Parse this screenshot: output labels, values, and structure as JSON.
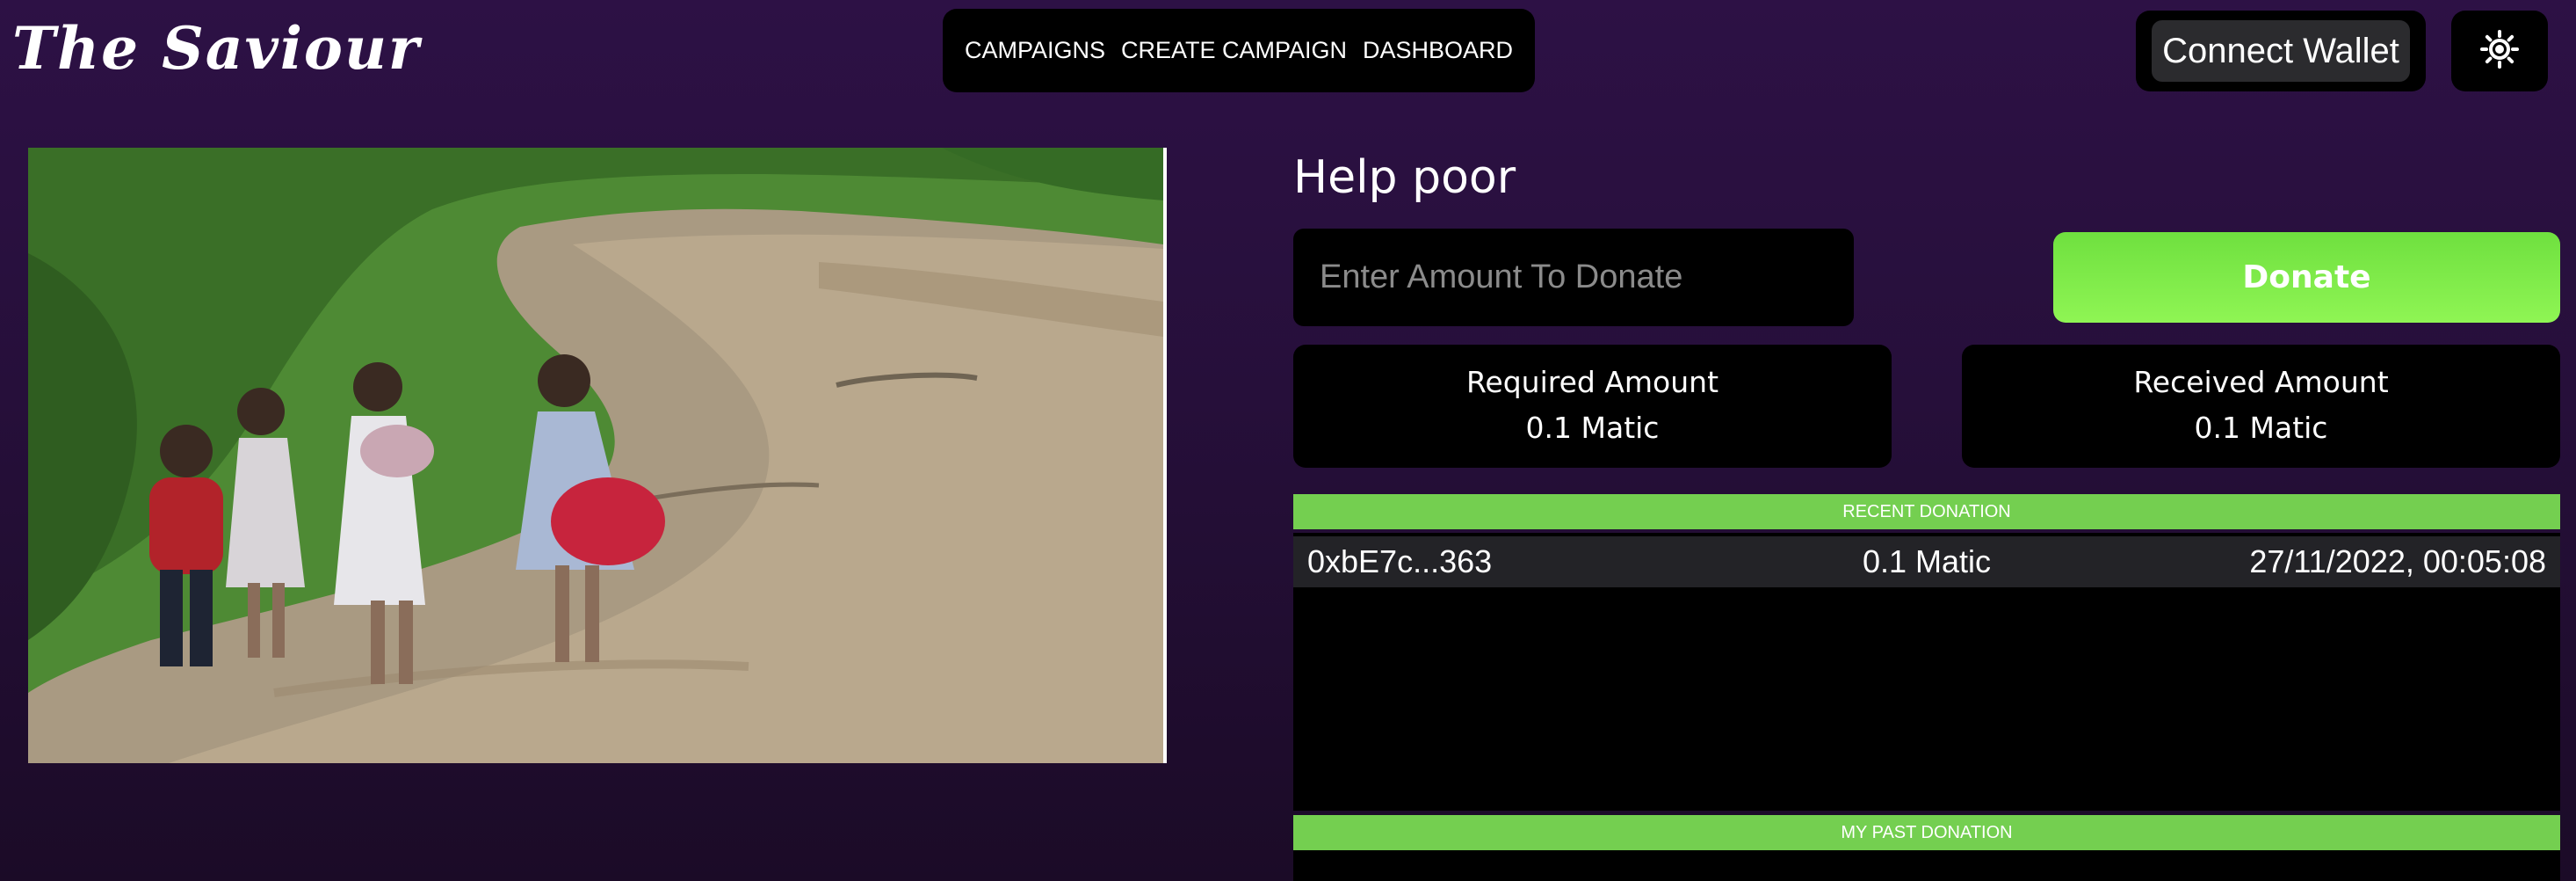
{
  "header": {
    "logo_text": "The Saviour",
    "nav": [
      {
        "label": "CAMPAIGNS"
      },
      {
        "label": "CREATE CAMPAIGN"
      },
      {
        "label": "DASHBOARD"
      }
    ],
    "connect_wallet_label": "Connect Wallet",
    "theme_toggle_icon": "sun-icon"
  },
  "campaign": {
    "image_subject": "campaign-photo",
    "title": "Help poor",
    "donate_input_placeholder": "Enter Amount To Donate",
    "donate_label": "Donate",
    "required": {
      "label": "Required Amount",
      "value": "0.1 Matic"
    },
    "received": {
      "label": "Received Amount",
      "value": "0.1 Matic"
    }
  },
  "recent_donations": {
    "header": "RECENT DONATION",
    "rows": [
      {
        "address": "0xbE7c...363",
        "amount": "0.1 Matic",
        "time": "27/11/2022, 00:05:08"
      }
    ]
  },
  "past_donations": {
    "header": "MY PAST DONATION"
  },
  "colors": {
    "background": "#2d1145",
    "panel": "#000000",
    "accent_green": "#74cf50",
    "donate_button": "#8ff554",
    "row_background": "#232327"
  }
}
